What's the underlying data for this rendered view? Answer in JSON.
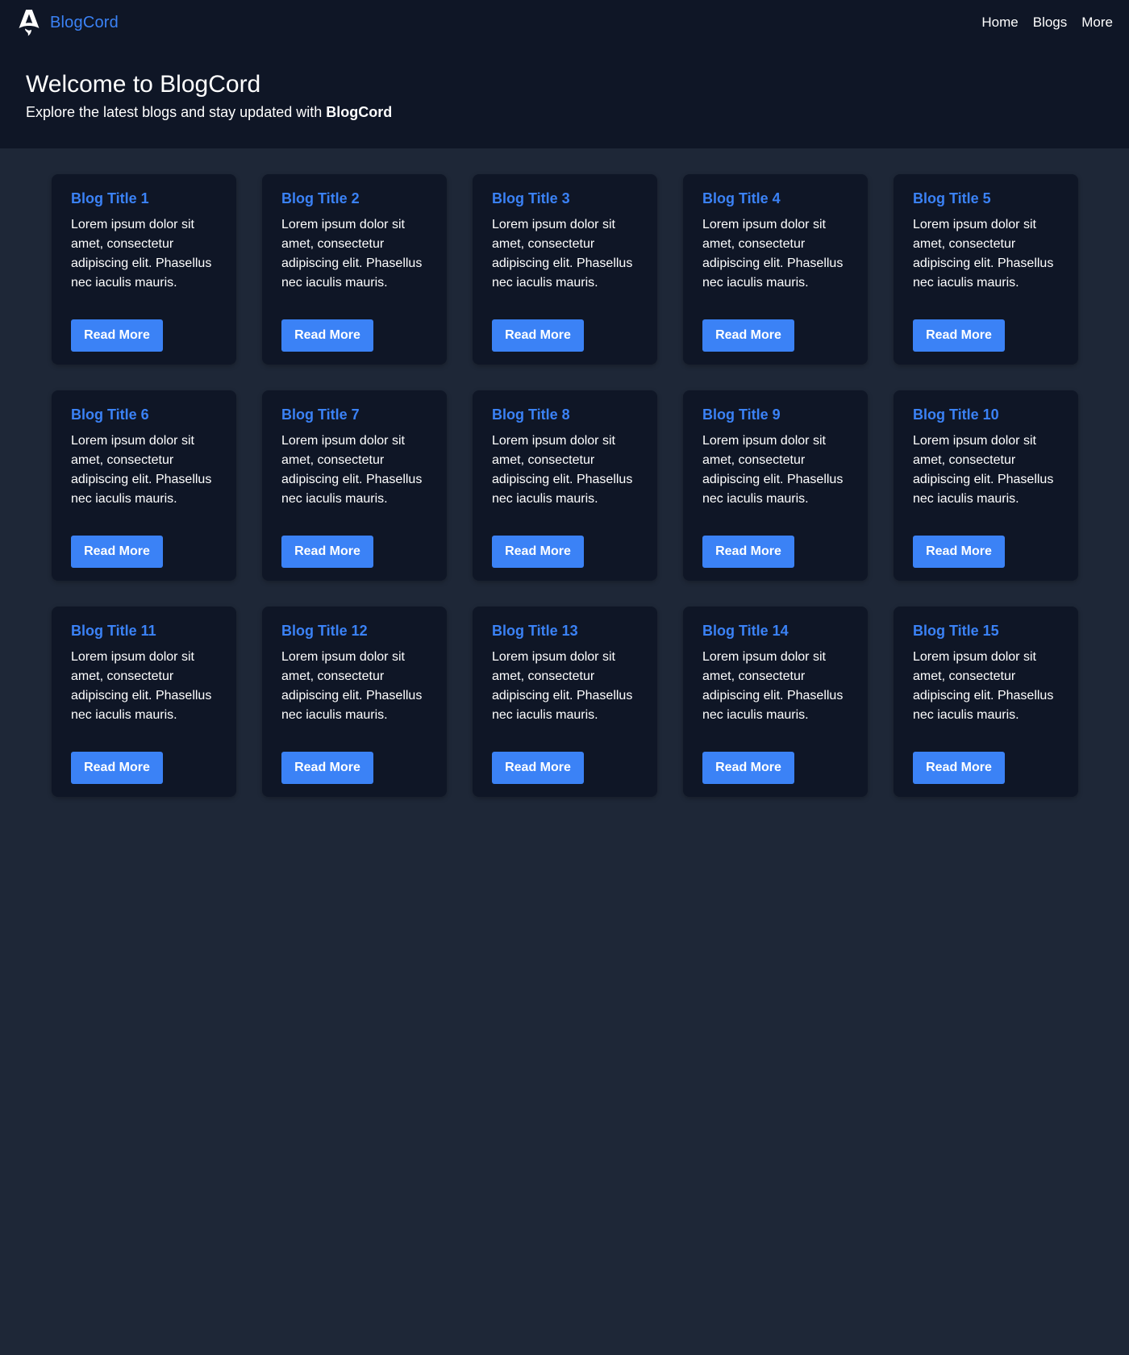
{
  "nav": {
    "brand": "BlogCord",
    "links": [
      "Home",
      "Blogs",
      "More"
    ]
  },
  "hero": {
    "title": "Welcome to BlogCord",
    "subtitle_prefix": "Explore the latest blogs and stay updated with ",
    "subtitle_bold": "BlogCord"
  },
  "cards": [
    {
      "title": "Blog Title 1",
      "text": "Lorem ipsum dolor sit amet, consectetur adipiscing elit. Phasellus nec iaculis mauris.",
      "button": "Read More"
    },
    {
      "title": "Blog Title 2",
      "text": "Lorem ipsum dolor sit amet, consectetur adipiscing elit. Phasellus nec iaculis mauris.",
      "button": "Read More"
    },
    {
      "title": "Blog Title 3",
      "text": "Lorem ipsum dolor sit amet, consectetur adipiscing elit. Phasellus nec iaculis mauris.",
      "button": "Read More"
    },
    {
      "title": "Blog Title 4",
      "text": "Lorem ipsum dolor sit amet, consectetur adipiscing elit. Phasellus nec iaculis mauris.",
      "button": "Read More"
    },
    {
      "title": "Blog Title 5",
      "text": "Lorem ipsum dolor sit amet, consectetur adipiscing elit. Phasellus nec iaculis mauris.",
      "button": "Read More"
    },
    {
      "title": "Blog Title 6",
      "text": "Lorem ipsum dolor sit amet, consectetur adipiscing elit. Phasellus nec iaculis mauris.",
      "button": "Read More"
    },
    {
      "title": "Blog Title 7",
      "text": "Lorem ipsum dolor sit amet, consectetur adipiscing elit. Phasellus nec iaculis mauris.",
      "button": "Read More"
    },
    {
      "title": "Blog Title 8",
      "text": "Lorem ipsum dolor sit amet, consectetur adipiscing elit. Phasellus nec iaculis mauris.",
      "button": "Read More"
    },
    {
      "title": "Blog Title 9",
      "text": "Lorem ipsum dolor sit amet, consectetur adipiscing elit. Phasellus nec iaculis mauris.",
      "button": "Read More"
    },
    {
      "title": "Blog Title 10",
      "text": "Lorem ipsum dolor sit amet, consectetur adipiscing elit. Phasellus nec iaculis mauris.",
      "button": "Read More"
    },
    {
      "title": "Blog Title 11",
      "text": "Lorem ipsum dolor sit amet, consectetur adipiscing elit. Phasellus nec iaculis mauris.",
      "button": "Read More"
    },
    {
      "title": "Blog Title 12",
      "text": "Lorem ipsum dolor sit amet, consectetur adipiscing elit. Phasellus nec iaculis mauris.",
      "button": "Read More"
    },
    {
      "title": "Blog Title 13",
      "text": "Lorem ipsum dolor sit amet, consectetur adipiscing elit. Phasellus nec iaculis mauris.",
      "button": "Read More"
    },
    {
      "title": "Blog Title 14",
      "text": "Lorem ipsum dolor sit amet, consectetur adipiscing elit. Phasellus nec iaculis mauris.",
      "button": "Read More"
    },
    {
      "title": "Blog Title 15",
      "text": "Lorem ipsum dolor sit amet, consectetur adipiscing elit. Phasellus nec iaculis mauris.",
      "button": "Read More"
    }
  ],
  "colors": {
    "accent": "#3b82f6",
    "header_bg": "#0f1626",
    "page_bg": "#1e2737",
    "card_bg": "#0f1626"
  },
  "icons": {
    "logo": "astro-logo-icon"
  }
}
